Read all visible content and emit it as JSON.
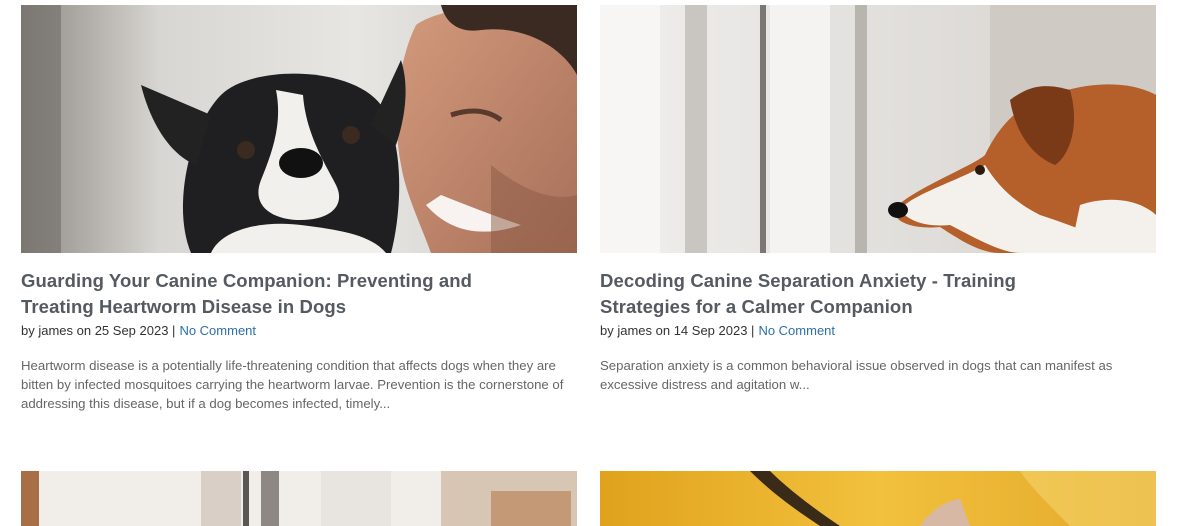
{
  "posts": [
    {
      "title_line1": "Guarding Your Canine Companion: Preventing and",
      "title_line2": "Treating Heartworm Disease in Dogs",
      "author_prefix": "by james on 25 Sep 2023 |",
      "comment_link": "No Comment",
      "excerpt": "Heartworm disease is a potentially life-threatening condition that affects dogs when they are bitten by infected mosquitoes carrying the heartworm larvae. Prevention is the cornerstone of addressing this disease, but if a dog becomes infected, timely..."
    },
    {
      "title_line1": "Decoding Canine Separation Anxiety - Training",
      "title_line2": "Strategies for a Calmer Companion",
      "author_prefix": "by james on 14 Sep 2023 |",
      "comment_link": "No Comment",
      "excerpt": "Separation anxiety is a common behavioral issue observed in dogs that can manifest as excessive distress and agitation w..."
    }
  ],
  "colors": {
    "title": "#555a60",
    "link": "#2d6fa8",
    "excerpt": "#666666"
  }
}
